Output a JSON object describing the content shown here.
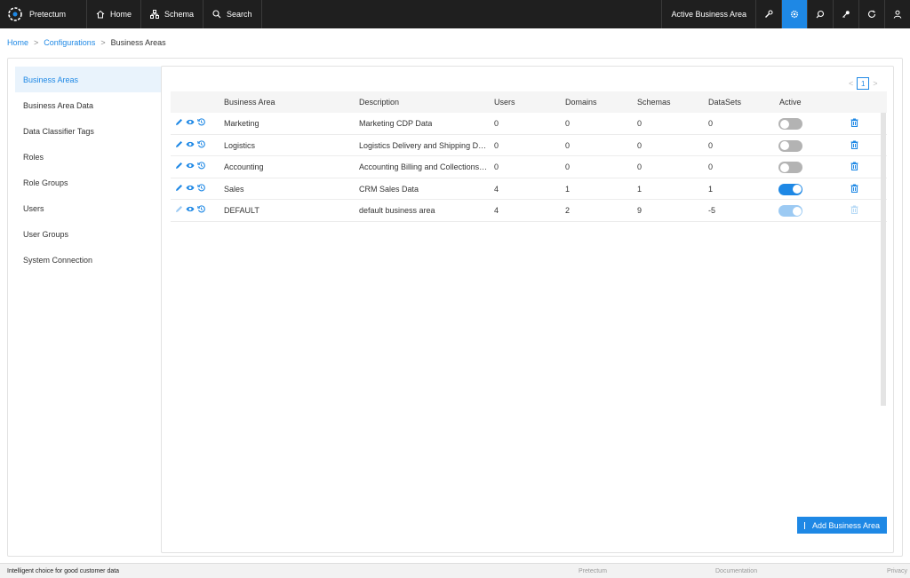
{
  "app": {
    "name": "Pretectum",
    "nav": [
      {
        "label": "Home",
        "icon": "home-icon"
      },
      {
        "label": "Schema",
        "icon": "schema-icon"
      },
      {
        "label": "Search",
        "icon": "search-icon"
      }
    ],
    "active_business_area_label": "Active Business Area",
    "right_icons": [
      "wrench-icon",
      "gear-icon",
      "magnify-icon",
      "key-icon",
      "refresh-icon",
      "user-icon"
    ]
  },
  "breadcrumb": {
    "home": "Home",
    "configurations": "Configurations",
    "current": "Business Areas",
    "sep": ">"
  },
  "sidebar": {
    "items": [
      {
        "label": "Business Areas",
        "active": true
      },
      {
        "label": "Business Area Data"
      },
      {
        "label": "Data Classifier Tags"
      },
      {
        "label": "Roles"
      },
      {
        "label": "Role Groups"
      },
      {
        "label": "Users"
      },
      {
        "label": "User Groups"
      },
      {
        "label": "System Connection"
      }
    ]
  },
  "pager": {
    "prev": "<",
    "page": "1",
    "next": ">"
  },
  "table": {
    "headers": [
      "Business Area",
      "Description",
      "Users",
      "Domains",
      "Schemas",
      "DataSets",
      "Active"
    ],
    "rows": [
      {
        "name": "Marketing",
        "description": "Marketing CDP Data",
        "users": "0",
        "domains": "0",
        "schemas": "0",
        "datasets": "0",
        "active": false
      },
      {
        "name": "Logistics",
        "description": "Logistics Delivery and Shipping Data",
        "users": "0",
        "domains": "0",
        "schemas": "0",
        "datasets": "0",
        "active": false
      },
      {
        "name": "Accounting",
        "description": "Accounting Billing and Collections D...",
        "users": "0",
        "domains": "0",
        "schemas": "0",
        "datasets": "0",
        "active": false
      },
      {
        "name": "Sales",
        "description": "CRM Sales Data",
        "users": "4",
        "domains": "1",
        "schemas": "1",
        "datasets": "1",
        "active": true
      },
      {
        "name": "DEFAULT",
        "description": "default business area",
        "users": "4",
        "domains": "2",
        "schemas": "9",
        "datasets": "-5",
        "active": true,
        "disabled": true
      }
    ]
  },
  "add_button_label": "Add Business Area",
  "footer": {
    "tagline": "Intelligent choice for good customer data",
    "links": [
      "Pretectum",
      "Documentation",
      "Privacy"
    ]
  },
  "colors": {
    "accent": "#1e88e5",
    "topbar": "#1f1f1f"
  }
}
